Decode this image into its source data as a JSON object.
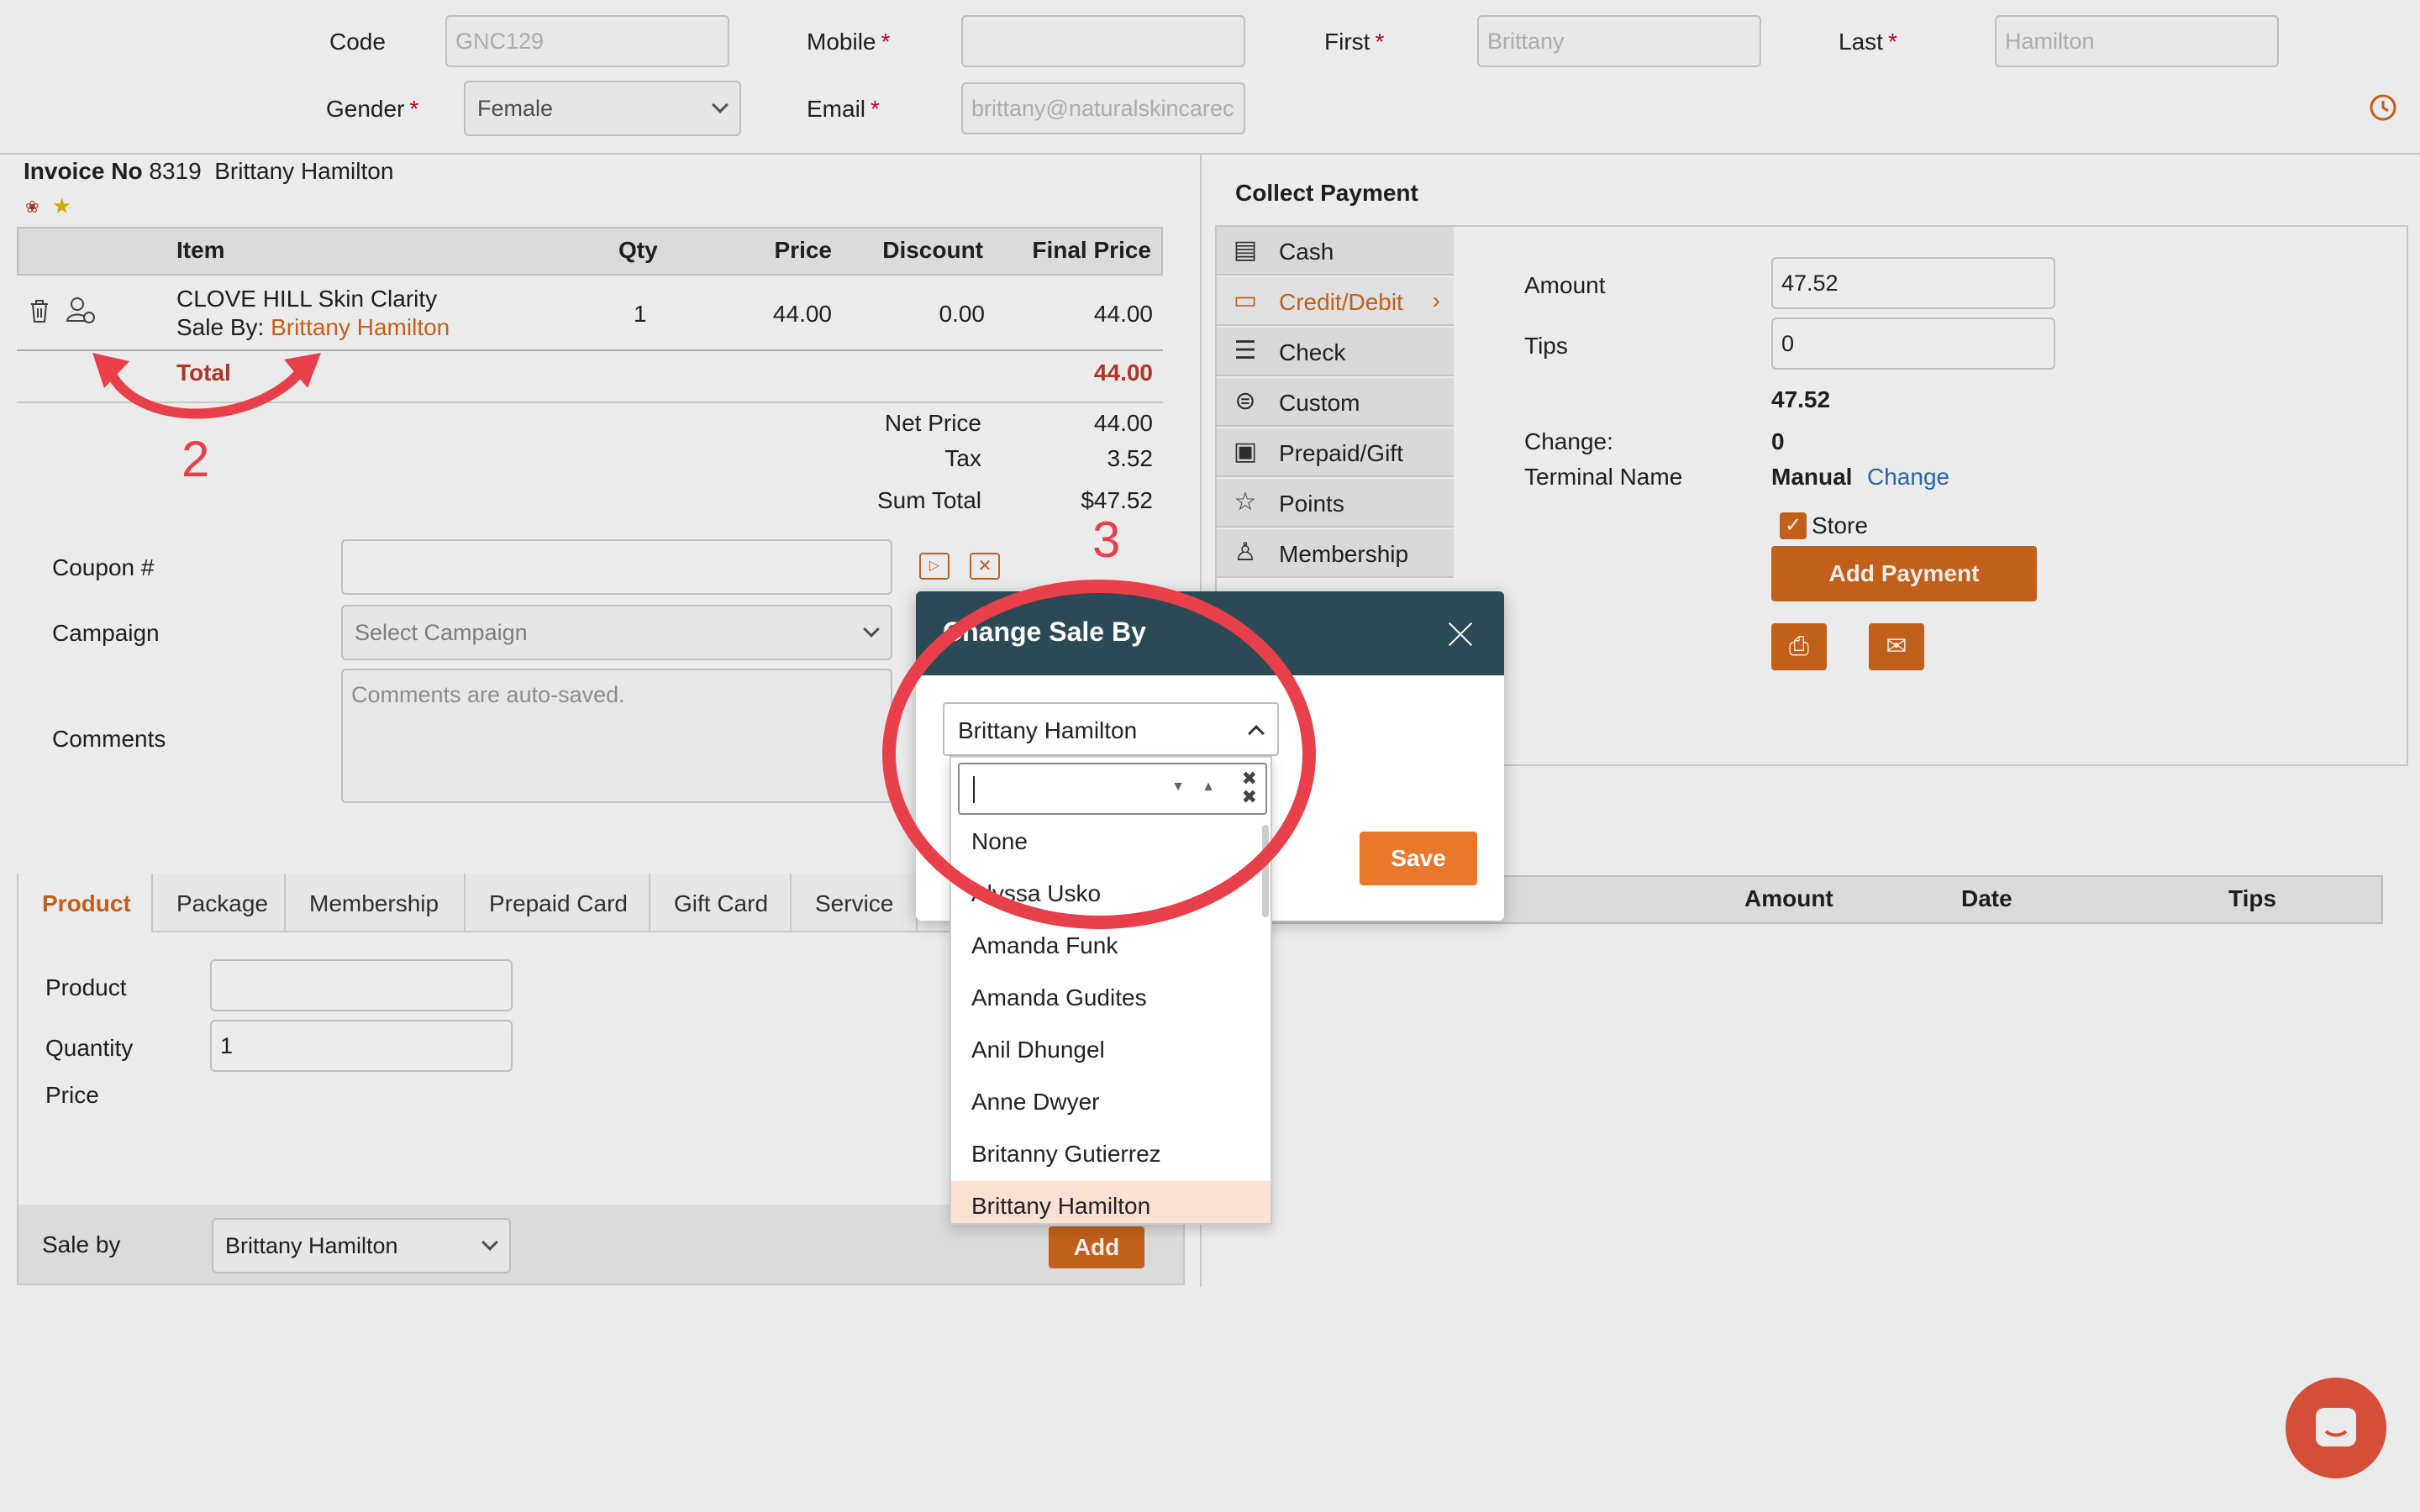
{
  "customer": {
    "code_label": "Code",
    "code_value": "GNC129",
    "mobile_label": "Mobile",
    "mobile_value": "",
    "first_label": "First",
    "first_value": "Brittany",
    "last_label": "Last",
    "last_value": "Hamilton",
    "gender_label": "Gender",
    "gender_value": "Female",
    "email_label": "Email",
    "email_value": "brittany@naturalskincarec",
    "required_mark": "*"
  },
  "invoice": {
    "label": "Invoice No",
    "number": "8319",
    "customer_name": "Brittany Hamilton",
    "columns": [
      "Item",
      "Qty",
      "Price",
      "Discount",
      "Final Price"
    ],
    "row": {
      "item": "CLOVE HILL Skin Clarity",
      "sale_by_label": "Sale By:",
      "sale_by": "Brittany Hamilton",
      "qty": "1",
      "price": "44.00",
      "discount": "0.00",
      "final_price": "44.00"
    },
    "total_label": "Total",
    "total_value": "44.00",
    "summary": [
      {
        "label": "Net Price",
        "value": "44.00"
      },
      {
        "label": "Tax",
        "value": "3.52"
      },
      {
        "label": "Sum Total",
        "value": "$47.52"
      }
    ]
  },
  "form": {
    "coupon_label": "Coupon #",
    "campaign_label": "Campaign",
    "campaign_placeholder": "Select Campaign",
    "comments_label": "Comments",
    "comments_placeholder": "Comments are auto-saved."
  },
  "tabs": [
    "Product",
    "Package",
    "Membership",
    "Prepaid Card",
    "Gift Card",
    "Service"
  ],
  "product_form": {
    "product_label": "Product",
    "quantity_label": "Quantity",
    "quantity_value": "1",
    "price_label": "Price",
    "sale_by_label": "Sale by",
    "sale_by_value": "Brittany Hamilton",
    "add_label": "Add"
  },
  "payment": {
    "title": "Collect Payment",
    "methods": [
      "Cash",
      "Credit/Debit",
      "Check",
      "Custom",
      "Prepaid/Gift",
      "Points",
      "Membership"
    ],
    "method_icons": [
      "cash-icon",
      "card-icon",
      "check-icon",
      "custom-icon",
      "prepaid-icon",
      "star-icon",
      "membership-icon"
    ],
    "active_method": "Credit/Debit",
    "amount_label": "Amount",
    "amount_value": "47.52",
    "tips_label": "Tips",
    "tips_value": "0",
    "total_value": "47.52",
    "change_label": "Change:",
    "change_value": "0",
    "terminal_label": "Terminal Name",
    "terminal_value": "Manual",
    "terminal_change": "Change",
    "store_label": "Store",
    "add_payment_label": "Add Payment",
    "history_columns": [
      "Amount",
      "Date",
      "Tips"
    ]
  },
  "modal": {
    "title": "Change Sale By",
    "selected": "Brittany Hamilton",
    "options": [
      "None",
      "Alyssa Usko",
      "Amanda Funk",
      "Amanda Gudites",
      "Anil Dhungel",
      "Anne Dwyer",
      "Britanny Gutierrez",
      "Brittany Hamilton"
    ],
    "save_label": "Save"
  },
  "annotations": {
    "step2": "2",
    "step3": "3"
  },
  "colors": {
    "accent": "#d2691e",
    "modal_header": "#2c4a55",
    "annotation": "#e8404a",
    "total_red": "#c0392b"
  }
}
